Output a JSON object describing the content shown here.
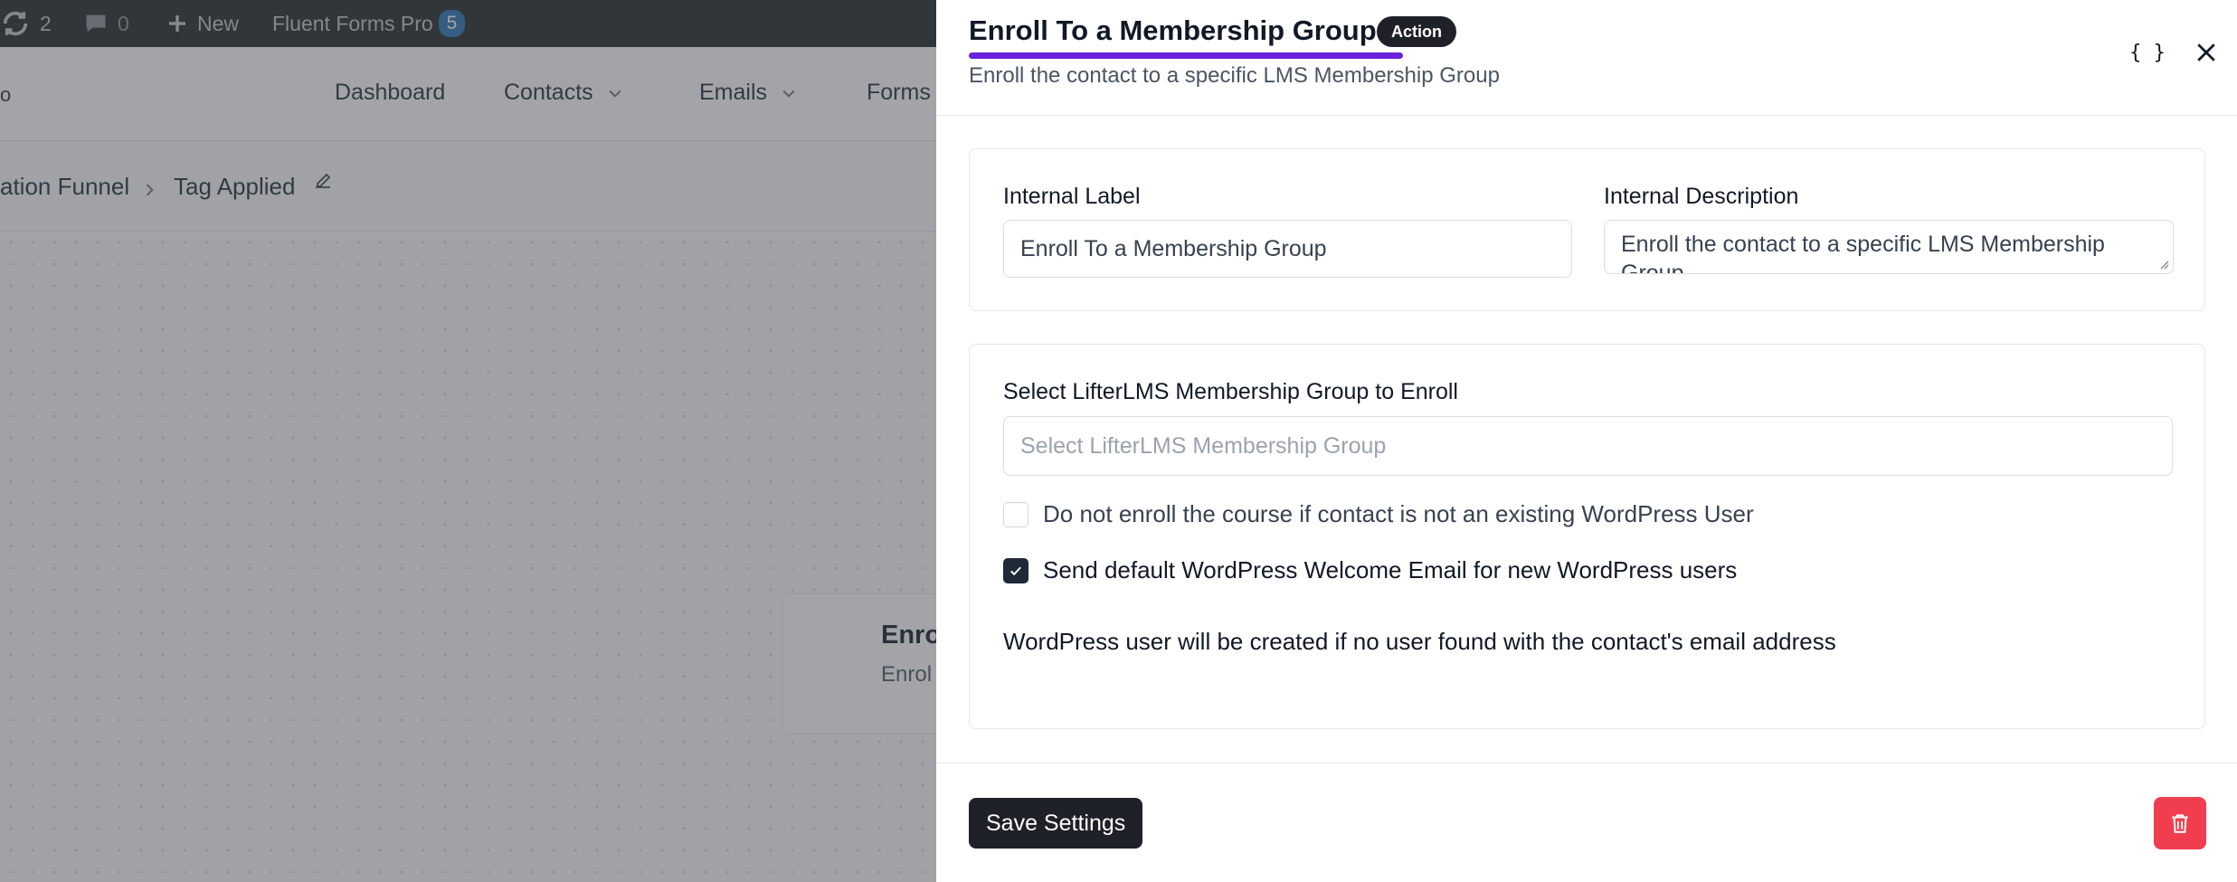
{
  "adminbar": {
    "updates_count": "2",
    "comments_count": "0",
    "new_label": "New",
    "plugin_label": "Fluent Forms Pro",
    "plugin_badge": "5"
  },
  "nav": {
    "brand_fragment": "o",
    "items": [
      "Dashboard",
      "Contacts",
      "Emails",
      "Forms"
    ]
  },
  "breadcrumb": {
    "parent": "ation Funnel",
    "current": "Tag Applied"
  },
  "canvas_node": {
    "title": "Enro",
    "description": "Enrol"
  },
  "drawer": {
    "title": "Enroll To a Membership Group",
    "badge": "Action",
    "subtitle": "Enroll the contact to a specific LMS Membership Group",
    "code_button_label": "{ }",
    "settings": {
      "internal_label_title": "Internal Label",
      "internal_label_value": "Enroll To a Membership Group",
      "internal_description_title": "Internal Description",
      "internal_description_value": "Enroll the contact to a specific LMS Membership Group"
    },
    "group": {
      "select_title": "Select LifterLMS Membership Group to Enroll",
      "select_placeholder": "Select LifterLMS Membership Group",
      "checkbox_existing_user": "Do not enroll the course if contact is not an existing WordPress User",
      "checkbox_existing_user_checked": false,
      "checkbox_welcome_email": "Send default WordPress Welcome Email for new WordPress users",
      "checkbox_welcome_email_checked": true,
      "note": "WordPress user will be created if no user found with the contact's email address"
    },
    "footer": {
      "save_label": "Save Settings"
    }
  },
  "colors": {
    "accent_underline": "#6b21d8",
    "dark_button": "#1f2128",
    "delete_button": "#f03e4e",
    "wp_badge": "#2271b1"
  }
}
